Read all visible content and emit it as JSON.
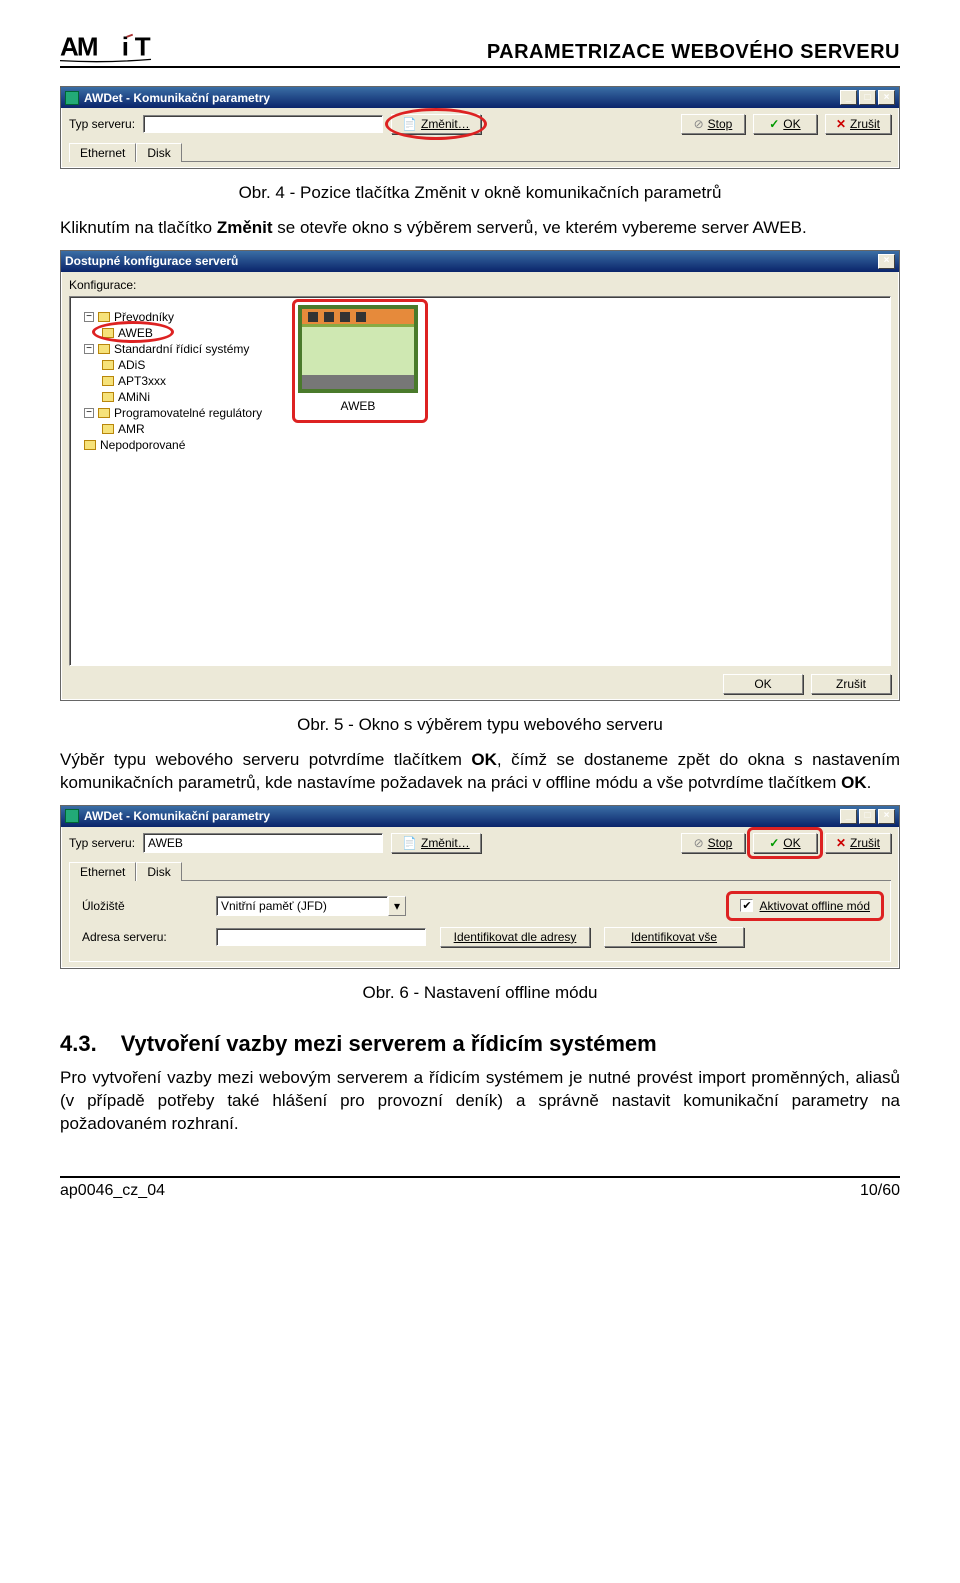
{
  "header": {
    "title": "PARAMETRIZACE WEBOVÉHO SERVERU"
  },
  "win1": {
    "title": "AWDet - Komunikační parametry",
    "typ_serveru_label": "Typ serveru:",
    "typ_serveru_value": "",
    "btn_zmenit": "Změnit…",
    "btn_stop": "Stop",
    "btn_ok": "OK",
    "btn_zrusit": "Zrušit",
    "tabs": [
      "Ethernet",
      "Disk"
    ]
  },
  "caption1": "Obr. 4 - Pozice tlačítka Změnit v okně komunikačních parametrů",
  "para1_pre": "Kliknutím na tlačítko ",
  "para1_bold": "Změnit",
  "para1_post": " se otevře okno s výběrem serverů, ve kterém vybereme server AWEB.",
  "win2": {
    "title": "Dostupné konfigurace serverů",
    "konfig_label": "Konfigurace:",
    "tree": {
      "root1": "Převodníky",
      "aweb": "AWEB",
      "root2": "Standardní řídicí systémy",
      "adis": "ADiS",
      "apt": "APT3xxx",
      "amini": "AMiNi",
      "root3": "Programovatelné regulátory",
      "amr": "AMR",
      "nepod": "Nepodporované"
    },
    "dev_label": "AWEB",
    "btn_ok": "OK",
    "btn_zrusit": "Zrušit"
  },
  "caption2": "Obr. 5 - Okno s výběrem typu webového serveru",
  "para2_pre": "Výběr typu webového serveru potvrdíme tlačítkem ",
  "para2_b1": "OK",
  "para2_mid": ", čímž se dostaneme zpět do okna s nastavením komunikačních parametrů, kde nastavíme požadavek na práci v offline módu a vše potvrdíme tlačítkem ",
  "para2_b2": "OK",
  "para2_post": ".",
  "win3": {
    "title": "AWDet - Komunikační parametry",
    "typ_serveru_label": "Typ serveru:",
    "typ_serveru_value": "AWEB",
    "btn_zmenit": "Změnit…",
    "btn_stop": "Stop",
    "btn_ok": "OK",
    "btn_zrusit": "Zrušit",
    "tabs": [
      "Ethernet",
      "Disk"
    ],
    "uloz_label": "Úložiště",
    "uloz_value": "Vnitřní paměť (JFD)",
    "offline_label": "Aktivovat offline mód",
    "adresa_label": "Adresa serveru:",
    "adresa_value": "",
    "btn_ident_adr": "Identifikovat dle adresy",
    "btn_ident_vse": "Identifikovat vše"
  },
  "caption3": "Obr. 6 - Nastavení offline módu",
  "section": {
    "num": "4.3.",
    "title": "Vytvoření vazby mezi serverem a řídicím systémem"
  },
  "para3": "Pro vytvoření vazby mezi webovým serverem a řídicím systémem je nutné provést import proměnných, aliasů (v případě potřeby také hlášení pro provozní deník) a správně nastavit komunikační parametry na požadovaném rozhraní.",
  "footer": {
    "left": "ap0046_cz_04",
    "right": "10/60"
  }
}
